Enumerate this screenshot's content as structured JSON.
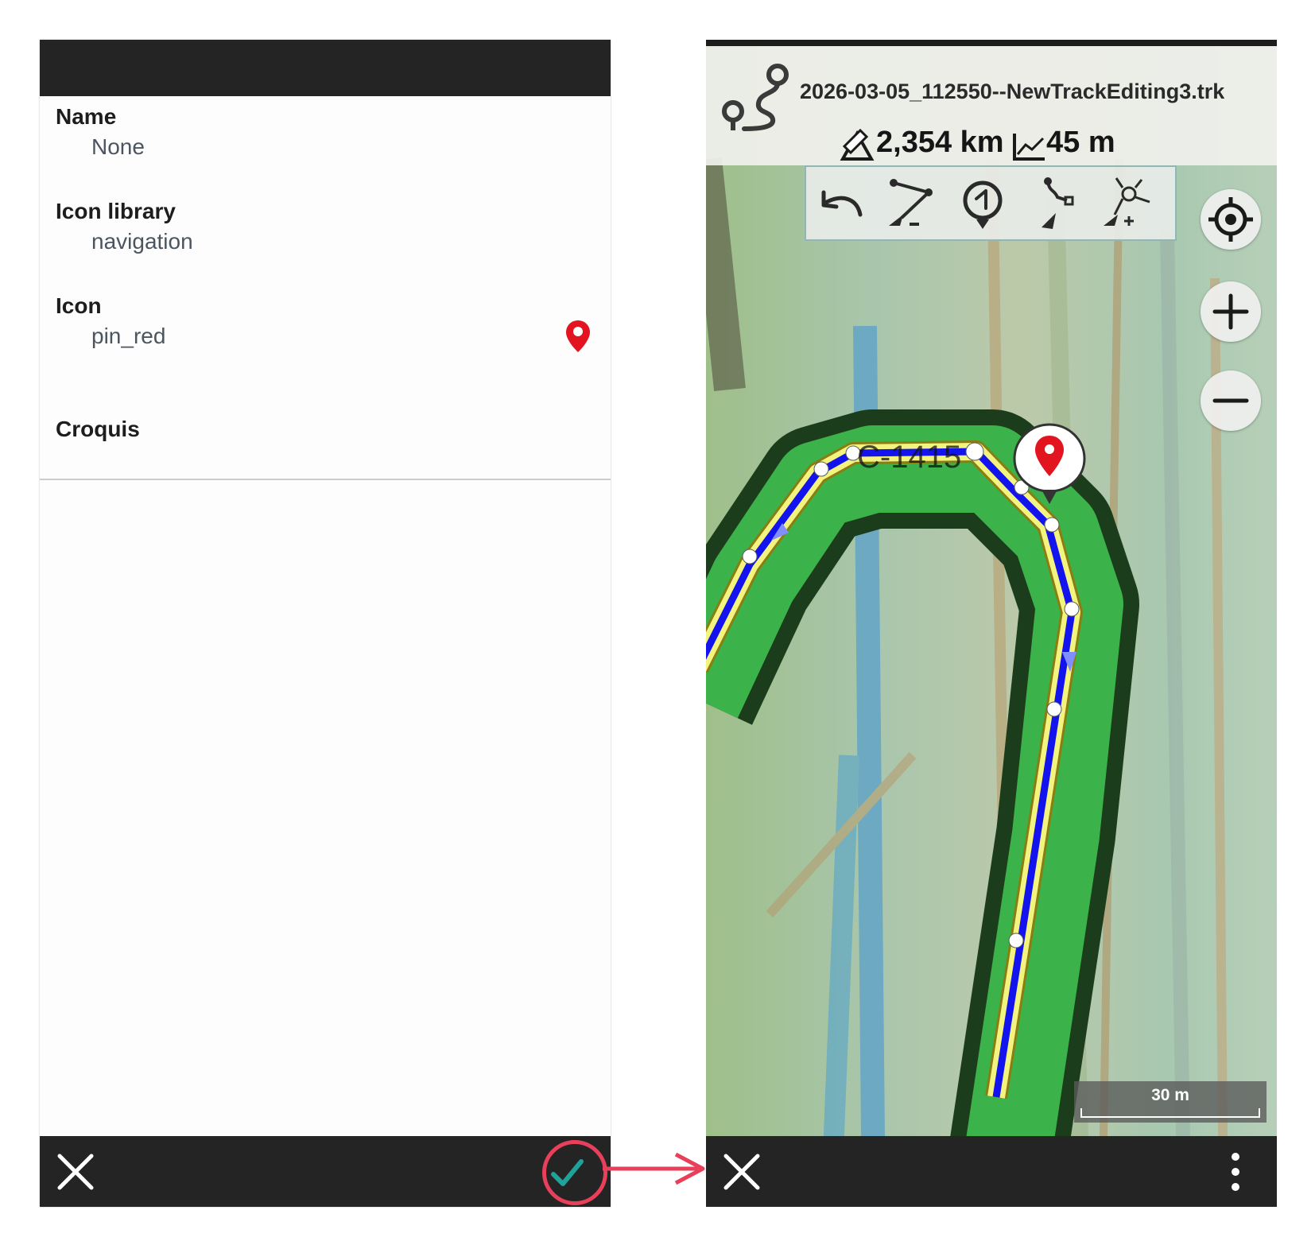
{
  "point_form": {
    "rows": [
      {
        "label": "Name",
        "value": "None"
      },
      {
        "label": "Icon library",
        "value": "navigation"
      },
      {
        "label": "Icon",
        "value": "pin_red"
      },
      {
        "label": "Croquis",
        "value": ""
      }
    ],
    "icon_color": "#e2141f",
    "bar_color": "#242424"
  },
  "track_editor": {
    "filename": "2026-03-05_112550--NewTrackEditing3.trk",
    "distance": "2,354 km",
    "elevation": "45 m",
    "map_labels": [
      "C-1415"
    ],
    "scale": "30 m",
    "track_color": "#1313ee",
    "tools": [
      "undo-icon",
      "delete-points-icon",
      "add-waypoint-icon",
      "move-point-icon",
      "add-points-icon"
    ]
  },
  "highlight_color": "#e8405a",
  "confirm_check_color": "#1fa29a"
}
